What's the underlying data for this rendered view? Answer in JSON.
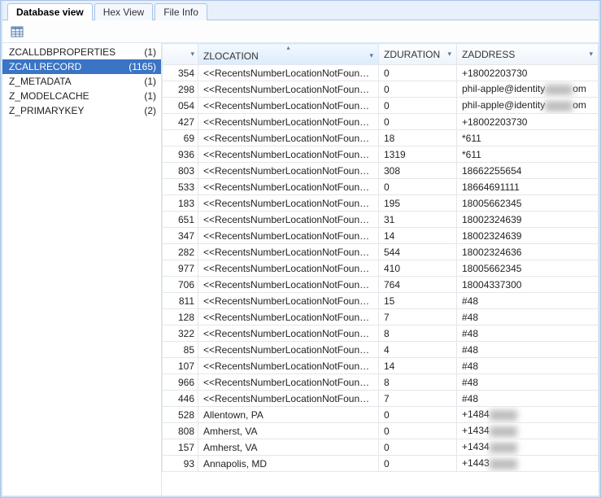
{
  "tabs": [
    {
      "label": "Database view",
      "active": true
    },
    {
      "label": "Hex View",
      "active": false
    },
    {
      "label": "File Info",
      "active": false
    }
  ],
  "sidebar": {
    "items": [
      {
        "name": "ZCALLDBPROPERTIES",
        "count": "(1)",
        "selected": false
      },
      {
        "name": "ZCALLRECORD",
        "count": "(1165)",
        "selected": true
      },
      {
        "name": "Z_METADATA",
        "count": "(1)",
        "selected": false
      },
      {
        "name": "Z_MODELCACHE",
        "count": "(1)",
        "selected": false
      },
      {
        "name": "Z_PRIMARYKEY",
        "count": "(2)",
        "selected": false
      }
    ]
  },
  "columns": {
    "id": "",
    "location": "ZLOCATION",
    "duration": "ZDURATION",
    "address": "ZADDRESS"
  },
  "rows": [
    {
      "id": "354",
      "loc": "<<RecentsNumberLocationNotFound>>",
      "dur": "0",
      "addr": "+18002203730"
    },
    {
      "id": "298",
      "loc": "<<RecentsNumberLocationNotFound>>",
      "dur": "0",
      "addr": "phil-apple@identity▒▒▒om"
    },
    {
      "id": "054",
      "loc": "<<RecentsNumberLocationNotFound>>",
      "dur": "0",
      "addr": "phil-apple@identity▒▒▒om"
    },
    {
      "id": "427",
      "loc": "<<RecentsNumberLocationNotFound>>",
      "dur": "0",
      "addr": "+18002203730"
    },
    {
      "id": "69",
      "loc": "<<RecentsNumberLocationNotFound>>",
      "dur": "18",
      "addr": "*611"
    },
    {
      "id": "936",
      "loc": "<<RecentsNumberLocationNotFound>>",
      "dur": "1319",
      "addr": "*611"
    },
    {
      "id": "803",
      "loc": "<<RecentsNumberLocationNotFound>>",
      "dur": "308",
      "addr": "18662255654"
    },
    {
      "id": "533",
      "loc": "<<RecentsNumberLocationNotFound>>",
      "dur": "0",
      "addr": "18664691111"
    },
    {
      "id": "183",
      "loc": "<<RecentsNumberLocationNotFound>>",
      "dur": "195",
      "addr": "18005662345"
    },
    {
      "id": "651",
      "loc": "<<RecentsNumberLocationNotFound>>",
      "dur": "31",
      "addr": "18002324639"
    },
    {
      "id": "347",
      "loc": "<<RecentsNumberLocationNotFound>>",
      "dur": "14",
      "addr": "18002324639"
    },
    {
      "id": "282",
      "loc": "<<RecentsNumberLocationNotFound>>",
      "dur": "544",
      "addr": "18002324636"
    },
    {
      "id": "977",
      "loc": "<<RecentsNumberLocationNotFound>>",
      "dur": "410",
      "addr": "18005662345"
    },
    {
      "id": "706",
      "loc": "<<RecentsNumberLocationNotFound>>",
      "dur": "764",
      "addr": "18004337300"
    },
    {
      "id": "811",
      "loc": "<<RecentsNumberLocationNotFound>>",
      "dur": "15",
      "addr": "#48"
    },
    {
      "id": "128",
      "loc": "<<RecentsNumberLocationNotFound>>",
      "dur": "7",
      "addr": "#48"
    },
    {
      "id": "322",
      "loc": "<<RecentsNumberLocationNotFound>>",
      "dur": "8",
      "addr": "#48"
    },
    {
      "id": "85",
      "loc": "<<RecentsNumberLocationNotFound>>",
      "dur": "4",
      "addr": "#48"
    },
    {
      "id": "107",
      "loc": "<<RecentsNumberLocationNotFound>>",
      "dur": "14",
      "addr": "#48"
    },
    {
      "id": "966",
      "loc": "<<RecentsNumberLocationNotFound>>",
      "dur": "8",
      "addr": "#48"
    },
    {
      "id": "446",
      "loc": "<<RecentsNumberLocationNotFound>>",
      "dur": "7",
      "addr": "#48"
    },
    {
      "id": "528",
      "loc": "Allentown, PA",
      "dur": "0",
      "addr": "+1484▒▒▒"
    },
    {
      "id": "808",
      "loc": "Amherst, VA",
      "dur": "0",
      "addr": "+1434▒▒▒"
    },
    {
      "id": "157",
      "loc": "Amherst, VA",
      "dur": "0",
      "addr": "+1434▒▒▒"
    },
    {
      "id": "93",
      "loc": "Annapolis, MD",
      "dur": "0",
      "addr": "+1443▒▒▒"
    }
  ],
  "icons": {
    "table": "table-icon"
  }
}
